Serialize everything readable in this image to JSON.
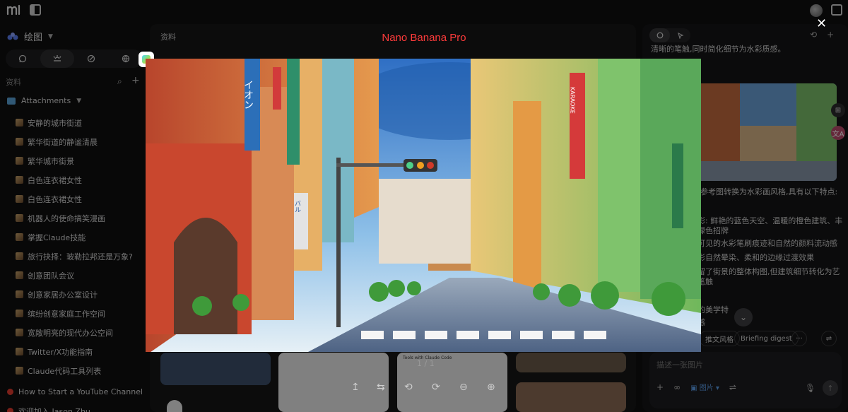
{
  "sidebar": {
    "workspace_name": "绘图",
    "section_label": "资料",
    "folder_label": "Attachments",
    "items": [
      "安静的城市街道",
      "繁华街道的静谧清晨",
      "繁华城市街景",
      "白色连衣裙女性",
      "白色连衣裙女性",
      "机器人的使命搞笑漫画",
      "掌握Claude技能",
      "旅行抉择：玻勒拉邦还是万象?",
      "创意团队会议",
      "创意家居办公室设计",
      "缤纷创意家庭工作空间",
      "宽敞明亮的现代办公空间",
      "Twitter/X功能指南",
      "Claude代码工具列表"
    ],
    "video_items": [
      "How to Start a YouTube Channel - ...",
      "欢迎加入 Jason Zhu..."
    ]
  },
  "main": {
    "label": "资料",
    "card_tools_title": "Tools with Claude Code"
  },
  "viewer": {
    "title": "Nano Banana Pro",
    "counter": "1 / 1",
    "close_glyph": "✕",
    "controls": [
      "↥",
      "⇆",
      "⟲",
      "⟳",
      "⊖",
      "⊕"
    ],
    "shop_signs": [
      "イオン",
      "KARAOKE",
      "バル"
    ]
  },
  "right_panel": {
    "lines": [
      "清晰的笔触,同时简化细节为水彩质感。",
      "参考图转换为水彩画风格,具有以下特点:",
      "彩: 鲜艳的蓝色天空、温暖的橙色建筑、丰",
      "绿色招牌",
      "可见的水彩笔刷痕迹和自然的颜料流动感",
      "彩自然晕染、柔和的边缘过渡效果",
      "留了街景的整体构图,但建筑细节转化为艺",
      "笔触",
      "的美学特",
      "感"
    ],
    "chip_style": "推文风格",
    "chip_digest": "Briefing digest",
    "chip_more": "···",
    "composer_placeholder": "描述一张图片",
    "image_button": "图片",
    "side_badge_label": "文A"
  },
  "colors": {
    "title_red": "#ff3b3b",
    "accent_blue": "#5a9be6",
    "youtube_red": "#e23b2e"
  }
}
